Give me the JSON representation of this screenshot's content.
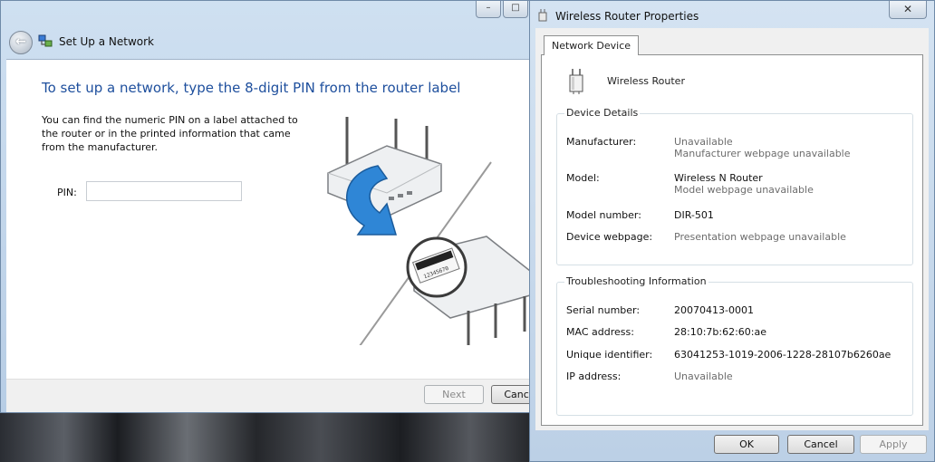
{
  "wizard": {
    "title": "Set Up a Network",
    "heading": "To set up a network, type the 8-digit PIN from the router label",
    "description": "You can find the numeric PIN on a label attached to the router or in the printed information that came from the manufacturer.",
    "pin_label": "PIN:",
    "pin_value": "",
    "next_label": "Next",
    "cancel_label": "Cancel",
    "minimize_glyph": "–",
    "maximize_glyph": "□",
    "back_glyph": "←"
  },
  "properties": {
    "title": "Wireless Router Properties",
    "close_glyph": "✕",
    "tab_label": "Network Device",
    "device_name": "Wireless Router",
    "device_details": {
      "label": "Device Details",
      "manufacturer_label": "Manufacturer:",
      "manufacturer_value": "Unavailable",
      "manufacturer_link": "Manufacturer webpage unavailable",
      "model_label": "Model:",
      "model_value": "Wireless N Router",
      "model_link": "Model webpage unavailable",
      "model_number_label": "Model number:",
      "model_number_value": "DIR-501",
      "device_webpage_label": "Device webpage:",
      "device_webpage_value": "Presentation webpage unavailable"
    },
    "troubleshooting": {
      "label": "Troubleshooting Information",
      "serial_label": "Serial number:",
      "serial_value": "20070413-0001",
      "mac_label": "MAC address:",
      "mac_value": "28:10:7b:62:60:ae",
      "uid_label": "Unique identifier:",
      "uid_value": "63041253-1019-2006-1228-28107b6260ae",
      "ip_label": "IP address:",
      "ip_value": "Unavailable"
    },
    "ok_label": "OK",
    "cancel_label": "Cancel",
    "apply_label": "Apply"
  },
  "illustration": {
    "label_text": "12345670"
  },
  "colors": {
    "heading_blue": "#1e4f9d",
    "arrow_blue": "#2f86d6"
  }
}
